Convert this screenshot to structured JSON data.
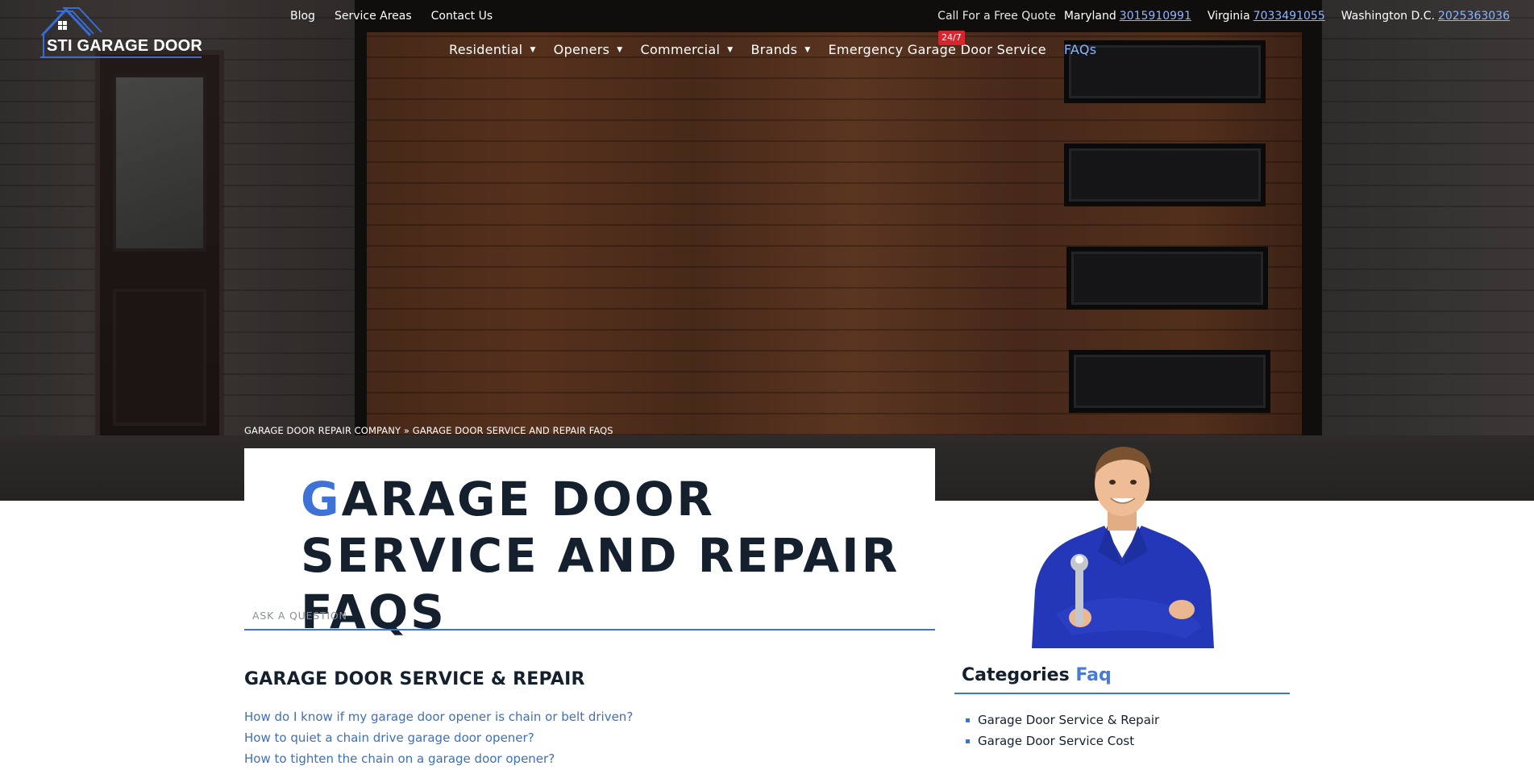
{
  "brand": {
    "name": "STI GARAGE DOOR",
    "accent": "#3f72d6"
  },
  "top_links": [
    "Blog",
    "Service Areas",
    "Contact Us"
  ],
  "phones": {
    "cta": "Call For a Free Quote",
    "entries": [
      {
        "region": "Maryland",
        "number": "3015910991"
      },
      {
        "region": "Virginia",
        "number": "7033491055"
      },
      {
        "region": "Washington D.C.",
        "number": "2025363036"
      }
    ]
  },
  "nav": {
    "items": [
      {
        "label": "Residential",
        "dropdown": true
      },
      {
        "label": "Openers",
        "dropdown": true
      },
      {
        "label": "Commercial",
        "dropdown": true
      },
      {
        "label": "Brands",
        "dropdown": true
      },
      {
        "label": "Emergency Garage Door Service",
        "dropdown": false
      },
      {
        "label": "FAQs",
        "dropdown": false,
        "active": true
      }
    ],
    "badge": "24/7"
  },
  "breadcrumb": "GARAGE DOOR REPAIR COMPANY » GARAGE DOOR SERVICE AND REPAIR FAQS",
  "page_title": {
    "first_letter": "G",
    "rest": "ARAGE DOOR SERVICE AND REPAIR FAQS"
  },
  "question": {
    "placeholder": "ASK A QUESTION"
  },
  "section": {
    "heading": "GARAGE DOOR SERVICE & REPAIR",
    "questions": [
      "How do I know if my garage door opener is chain or belt driven?",
      "How to quiet a chain drive garage door opener?",
      "How to tighten the chain on a garage door opener?"
    ]
  },
  "sidebar": {
    "heading": "Categories",
    "heading_accent": "Faq",
    "categories": [
      "Garage Door Service & Repair",
      "Garage Door Service Cost"
    ]
  }
}
